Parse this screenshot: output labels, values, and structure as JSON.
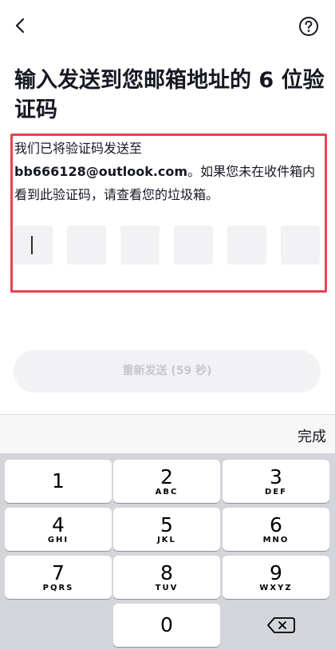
{
  "title": "输入发送到您邮箱地址的 6 位验证码",
  "description": {
    "prefix": "我们已将验证码发送至",
    "email": "bb666128@outlook.com",
    "suffix": "。如果您未在收件箱内看到此验证码，请查看您的垃圾箱。"
  },
  "code_length": 6,
  "code_values": [
    "",
    "",
    "",
    "",
    "",
    ""
  ],
  "resend_label": "重新发送 (59 秒)",
  "keyboard": {
    "done_label": "完成",
    "keys": [
      {
        "num": "1",
        "letters": ""
      },
      {
        "num": "2",
        "letters": "ABC"
      },
      {
        "num": "3",
        "letters": "DEF"
      },
      {
        "num": "4",
        "letters": "GHI"
      },
      {
        "num": "5",
        "letters": "JKL"
      },
      {
        "num": "6",
        "letters": "MNO"
      },
      {
        "num": "7",
        "letters": "PQRS"
      },
      {
        "num": "8",
        "letters": "TUV"
      },
      {
        "num": "9",
        "letters": "WXYZ"
      },
      {
        "num": "0",
        "letters": ""
      }
    ]
  },
  "icons": {
    "back": "chevron-left-icon",
    "help": "question-circle-icon",
    "backspace": "backspace-icon"
  },
  "colors": {
    "highlight_border": "#e8434f",
    "input_box": "#f2f2f4",
    "keyboard_bg": "#d3d5db"
  }
}
